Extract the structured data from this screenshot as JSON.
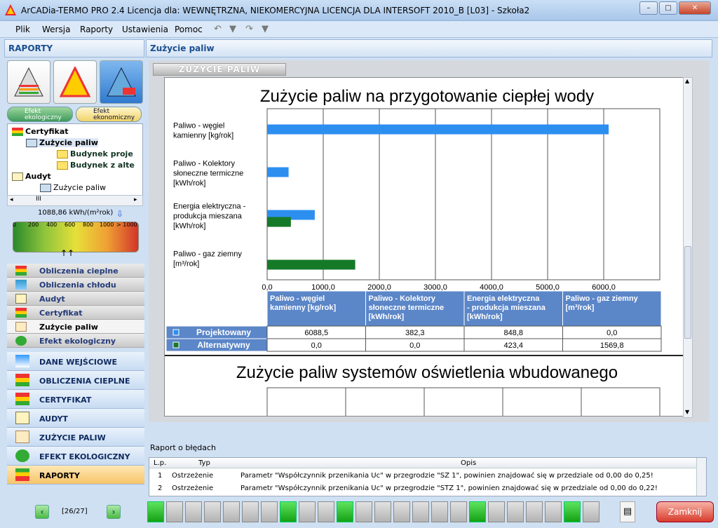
{
  "window": {
    "title": "ArCADia-TERMO PRO 2.4 Licencja dla: WEWNĘTRZNA, NIEKOMERCYJNA LICENCJA DLA INTERSOFT 2010_B [L03] - Szkoła2",
    "min": "–",
    "max": "□",
    "close": "✕"
  },
  "menu": [
    "Plik",
    "Wersja",
    "Raporty",
    "Ustawienia",
    "Pomoc"
  ],
  "left": {
    "header": "RAPORTY",
    "efekt_ekologiczny": "Efekt ekologiczny",
    "efekt_ekonomiczny": "Efekt ekonomiczny",
    "tree": [
      "Certyfikat",
      "Zużycie paliw",
      "Budynek proje",
      "Budynek z alte",
      "Audyt",
      "Zużycie paliw"
    ],
    "scroll_mark": "III",
    "scale_value": "1088,86 kWh/(m²rok)",
    "scale_ticks": [
      "0",
      "200",
      "400",
      "600",
      "800",
      "1000",
      "> 1000"
    ],
    "sub_items": [
      "Obliczenia cieplne",
      "Obliczenia chłodu",
      "Audyt",
      "Certyfikat",
      "Zużycie paliw",
      "Efekt ekologiczny"
    ],
    "main_items": [
      "DANE WEJŚCIOWE",
      "OBLICZENIA CIEPLNE",
      "CERTYFIKAT",
      "AUDYT",
      "ZUŻYCIE PALIW",
      "EFEKT EKOLOGICZNY",
      "RAPORTY"
    ],
    "pager": "[26/27]"
  },
  "right": {
    "header": "Zużycie paliw",
    "tab": "ZUŻYCIE PALIW",
    "chart_title": "Zużycie paliw na przygotowanie ciepłej wody",
    "second_title": "Zużycie paliw systemów oświetlenia wbudowanego",
    "colors": {
      "projektowany": "#2c8ff0",
      "alternatywny": "#157a28",
      "tablehdr": "#5b86c8"
    }
  },
  "chart_data": {
    "type": "bar",
    "orientation": "horizontal",
    "title": "Zużycie paliw na przygotowanie ciepłej wody",
    "categories": [
      "Paliwo - węgiel kamienny [kg/rok]",
      "Paliwo - Kolektory słoneczne termiczne [kWh/rok]",
      "Energia elektryczna - produkcja mieszana [kWh/rok]",
      "Paliwo - gaz ziemny [m³/rok]"
    ],
    "series": [
      {
        "name": "Projektowany",
        "values": [
          6088.5,
          382.3,
          848.8,
          0.0
        ]
      },
      {
        "name": "Alternatywny",
        "values": [
          0.0,
          0.0,
          423.4,
          1569.8
        ]
      }
    ],
    "xlim": [
      0,
      7000
    ],
    "xticks": [
      "0,0",
      "1000,0",
      "2000,0",
      "3000,0",
      "4000,0",
      "5000,0",
      "6000,0"
    ],
    "table": {
      "headers": [
        "Paliwo - węgiel kamienny [kg/rok]",
        "Paliwo - Kolektory słoneczne termiczne [kWh/rok]",
        "Energia elektryczna - produkcja mieszana [kWh/rok]",
        "Paliwo - gaz ziemny [m³/rok]"
      ],
      "rows": [
        {
          "name": "Projektowany",
          "values": [
            "6088,5",
            "382,3",
            "848,8",
            "0,0"
          ]
        },
        {
          "name": "Alternatywny",
          "values": [
            "0,0",
            "0,0",
            "423,4",
            "1569,8"
          ]
        }
      ]
    }
  },
  "errors": {
    "label": "Raport o błędach",
    "columns": [
      "L.p.",
      "Typ",
      "Opis"
    ],
    "rows": [
      {
        "lp": "1",
        "typ": "Ostrzeżenie",
        "opis": "Parametr \"Współczynnik przenikania Uc\" w przegrodzie \"SZ 1\", powinien znajdować się w przedziale od 0,00 do 0,25!"
      },
      {
        "lp": "2",
        "typ": "Ostrzeżenie",
        "opis": "Parametr \"Współczynnik przenikania Uc\" w przegrodzie \"STZ 1\", powinien znajdować się w przedziale od 0,00 do 0,22!"
      }
    ]
  },
  "status": {
    "squares": [
      true,
      false,
      false,
      false,
      false,
      false,
      false,
      true,
      false,
      false,
      true,
      false,
      false,
      false,
      false,
      false,
      false,
      true,
      false,
      false,
      false,
      false,
      true,
      false
    ],
    "close_button": "Zamknij"
  }
}
